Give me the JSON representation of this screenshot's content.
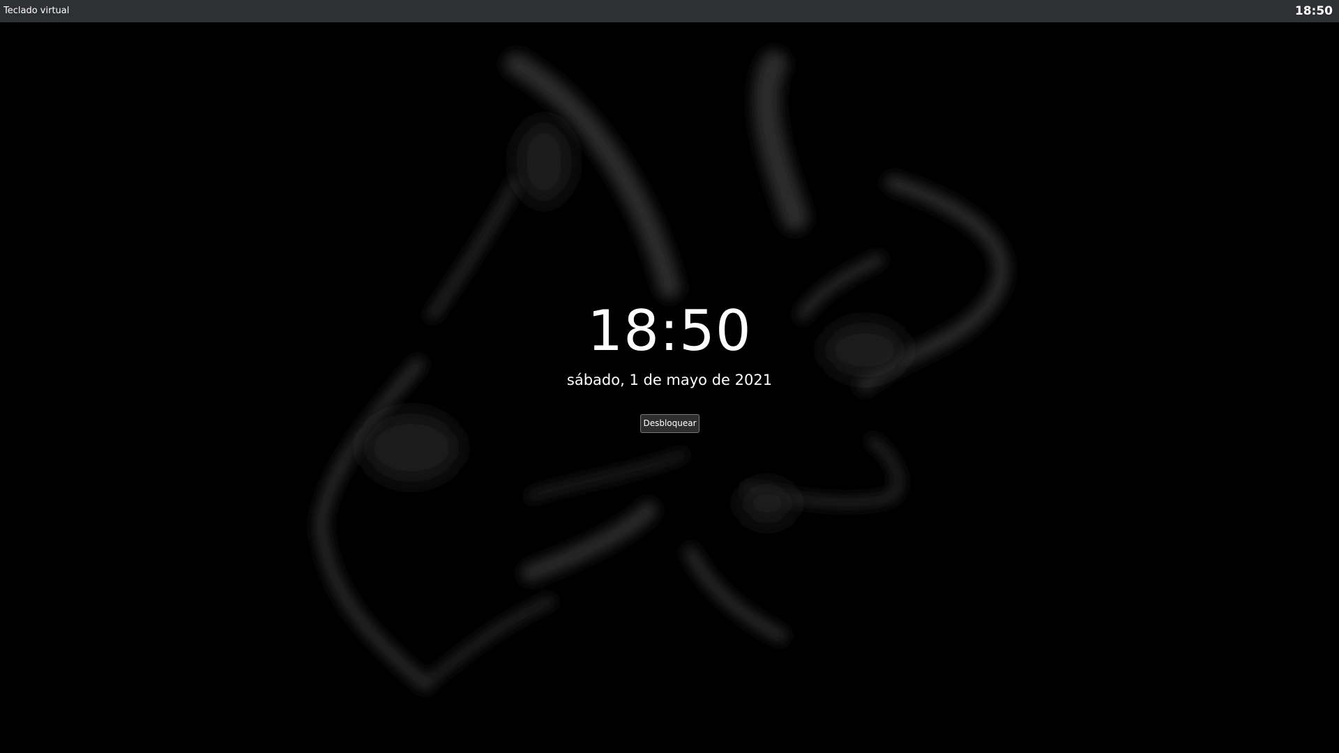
{
  "panel": {
    "left_label": "Teclado virtual",
    "clock": "18:50"
  },
  "lockscreen": {
    "time": "18:50",
    "date": "sábado, 1 de mayo de 2021",
    "unlock_label": "Desbloquear"
  },
  "colors": {
    "panel_bg": "#2f3033",
    "background": "#000000",
    "text": "#ffffff",
    "button_bg": "#2e2e2e",
    "button_border": "#7a7a7a"
  }
}
